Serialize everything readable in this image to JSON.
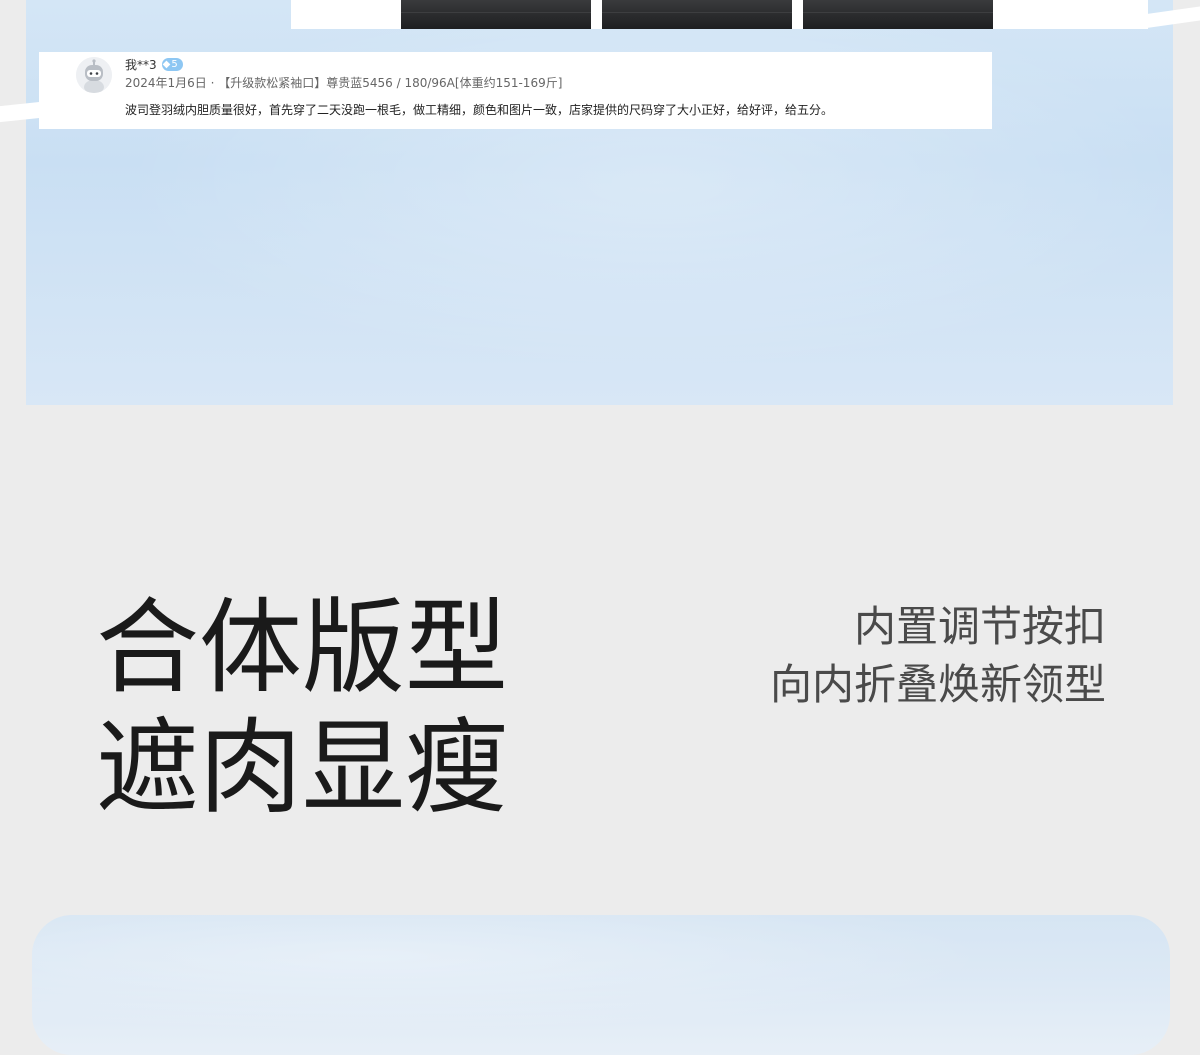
{
  "review": {
    "username": "我**3",
    "badge_level": "5",
    "badge_icon": "diamond-icon",
    "meta": "2024年1月6日 · 【升级款松紧袖口】尊贵蓝5456 / 180/96A[体重约151-169斤]",
    "text": "波司登羽绒内胆质量很好，首先穿了二天没跑一根毛，做工精细，颜色和图片一致，店家提供的尺码穿了大小正好，给好评，给五分。"
  },
  "headline": {
    "line1": "合体版型",
    "line2": "遮肉显瘦"
  },
  "subhead": {
    "line1": "内置调节按扣",
    "line2": "向内折叠焕新领型"
  },
  "colors": {
    "panel_blue": "#c9dff3",
    "badge_blue": "#8ec7f3",
    "page_bg": "#ececec"
  }
}
